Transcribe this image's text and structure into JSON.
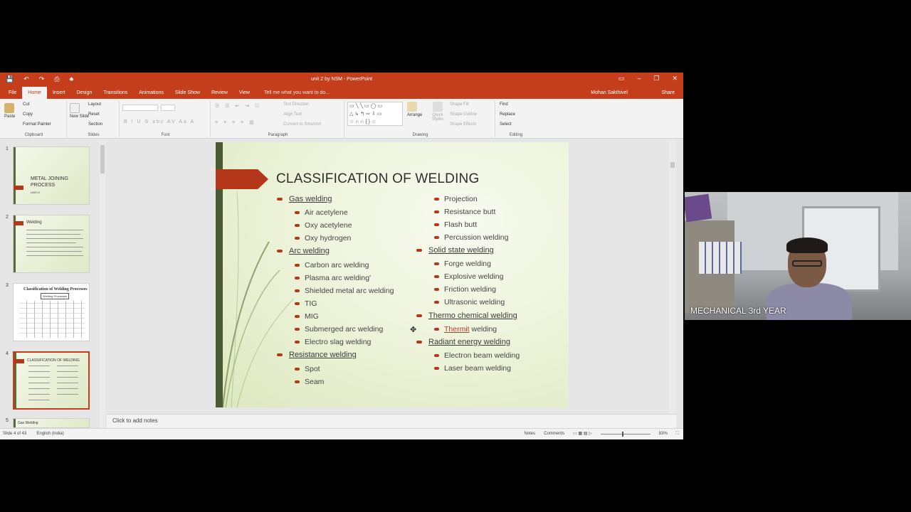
{
  "window": {
    "title": "unit 2 by NSM - PowerPoint",
    "qat": [
      "💾",
      "↶",
      "↷",
      "⎙",
      "♣"
    ],
    "controls": [
      "▭",
      "–",
      "❐",
      "✕"
    ]
  },
  "tabs": {
    "file": "File",
    "items": [
      "Home",
      "Insert",
      "Design",
      "Transitions",
      "Animations",
      "Slide Show",
      "Review",
      "View"
    ],
    "tell_me": "Tell me what you want to do...",
    "user": "Mohan Sakthivel",
    "share": "Share"
  },
  "ribbon": {
    "clipboard": {
      "paste": "Paste",
      "cut": "Cut",
      "copy": "Copy",
      "format_painter": "Format Painter",
      "label": "Clipboard"
    },
    "slides": {
      "new_slide": "New Slide",
      "layout": "Layout",
      "reset": "Reset",
      "section": "Section",
      "label": "Slides"
    },
    "font": {
      "label": "Font",
      "styles": "B I U S abc AV Aa A"
    },
    "paragraph": {
      "text_direction": "Text Direction",
      "align_text": "Align Text",
      "convert": "Convert to SmartArt",
      "label": "Paragraph"
    },
    "drawing": {
      "arrange": "Arrange",
      "quick_styles": "Quick Styles",
      "shape_fill": "Shape Fill",
      "shape_outline": "Shape Outline",
      "shape_effects": "Shape Effects",
      "label": "Drawing",
      "shapes": "▭╲╲▭◯▭\n△↳↰⇨⇩▭\n☆∩∩{}☆"
    },
    "editing": {
      "find": "Find",
      "replace": "Replace",
      "select": "Select",
      "label": "Editing"
    }
  },
  "thumbnails": [
    {
      "num": "1",
      "title": "METAL JOINING PROCESS",
      "subtitle": "UNIT-II"
    },
    {
      "num": "2",
      "title": "Welding"
    },
    {
      "num": "3",
      "title": "Classification of Welding Processes",
      "sub": "Welding Processes"
    },
    {
      "num": "4",
      "title": "CLASSIFICATION OF WELDING"
    },
    {
      "num": "5",
      "title": "Gas Welding"
    }
  ],
  "slide": {
    "title": "CLASSIFICATION OF WELDING",
    "left_column": [
      {
        "text": "Gas welding",
        "level": 1
      },
      {
        "text": "Air acetylene",
        "level": 2
      },
      {
        "text": "Oxy acetylene",
        "level": 2
      },
      {
        "text": "Oxy hydrogen",
        "level": 2
      },
      {
        "text": "Arc welding",
        "level": 1
      },
      {
        "text": "Carbon arc welding",
        "level": 2
      },
      {
        "text": "Plasma arc welding'",
        "level": 2
      },
      {
        "text": "Shielded metal arc welding",
        "level": 2
      },
      {
        "text": "TIG",
        "level": 2
      },
      {
        "text": "MIG",
        "level": 2
      },
      {
        "text": "Submerged arc welding",
        "level": 2
      },
      {
        "text": "Electro slag welding",
        "level": 2
      },
      {
        "text": "Resistance welding",
        "level": 1
      },
      {
        "text": "Spot",
        "level": 2
      },
      {
        "text": "Seam",
        "level": 2
      }
    ],
    "right_column": [
      {
        "text": "Projection",
        "level": 2
      },
      {
        "text": "Resistance butt",
        "level": 2
      },
      {
        "text": "Flash butt",
        "level": 2
      },
      {
        "text": "Percussion welding",
        "level": 2
      },
      {
        "text": "Solid state welding",
        "level": 1
      },
      {
        "text": "Forge welding",
        "level": 2
      },
      {
        "text": "Explosive welding",
        "level": 2
      },
      {
        "text": "Friction welding",
        "level": 2
      },
      {
        "text": "Ultrasonic welding",
        "level": 2
      },
      {
        "text": "Thermo chemical welding",
        "level": 1
      },
      {
        "text": "Thermit welding",
        "level": 2,
        "misspelled": "Thermit",
        "rest": " welding"
      },
      {
        "text": "Radiant energy welding",
        "level": 1
      },
      {
        "text": "Electron beam welding",
        "level": 2
      },
      {
        "text": "Laser beam welding",
        "level": 2
      }
    ]
  },
  "notes_placeholder": "Click to add notes",
  "status": {
    "slide_counter": "Slide 4 of 43",
    "language": "English (India)",
    "notes": "Notes",
    "comments": "Comments",
    "zoom": "83%"
  },
  "webcam": {
    "label": "MECHANICAL 3rd YEAR"
  },
  "colors": {
    "accent": "#c43e1c",
    "bullet": "#b5371a",
    "slide_bar": "#4c5a33"
  }
}
